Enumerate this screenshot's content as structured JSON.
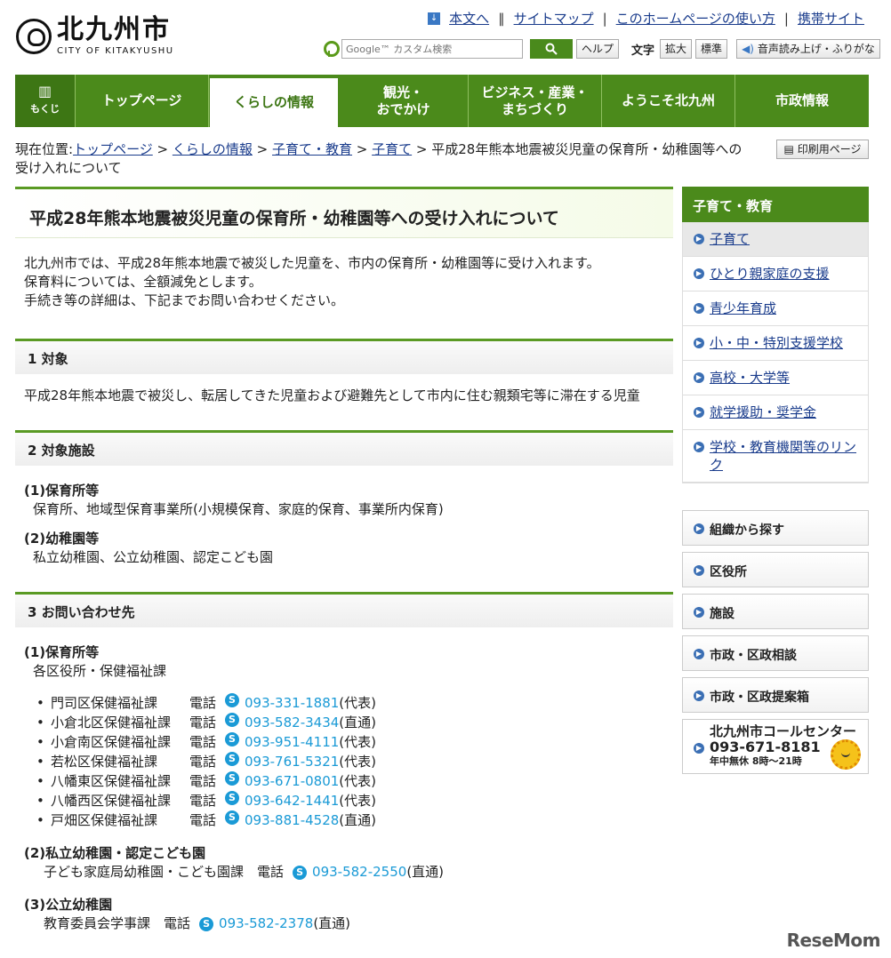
{
  "header": {
    "logo_ja": "北九州市",
    "logo_en": "CITY OF KITAKYUSHU",
    "toplinks": [
      "本文へ",
      "サイトマップ",
      "このホームページの使い方",
      "携帯サイト"
    ],
    "search_placeholder": "Google™ カスタム検索",
    "help_label": "ヘルプ",
    "text_label": "文字",
    "zoom_label": "拡大",
    "standard_label": "標準",
    "voice_label": "音声読み上げ・ふりがな"
  },
  "nav": {
    "mokuji": "もくじ",
    "items": [
      "トップページ",
      "くらしの情報",
      "観光・\nおでかけ",
      "ビジネス・産業・\nまちづくり",
      "ようこそ北九州",
      "市政情報"
    ]
  },
  "breadcrumb": {
    "prefix": "現在位置:",
    "links": [
      "トップページ",
      "くらしの情報",
      "子育て・教育",
      "子育て"
    ],
    "current": "平成28年熊本地震被災児童の保育所・幼稚園等への受け入れについて",
    "print_label": "印刷用ページ"
  },
  "main": {
    "title": "平成28年熊本地震被災児童の保育所・幼稚園等への受け入れについて",
    "intro": [
      "北九州市では、平成28年熊本地震で被災した児童を、市内の保育所・幼稚園等に受け入れます。",
      "保育料については、全額減免とします。",
      "手続き等の詳細は、下記までお問い合わせください。"
    ],
    "section1": {
      "heading": "1 対象",
      "body": "平成28年熊本地震で被災し、転居してきた児童および避難先として市内に住む親類宅等に滞在する児童"
    },
    "section2": {
      "heading": "2 対象施設",
      "sub1_title": "(1)保育所等",
      "sub1_body": "保育所、地域型保育事業所(小規模保育、家庭的保育、事業所内保育)",
      "sub2_title": "(2)幼稚園等",
      "sub2_body": "私立幼稚園、公立幼稚園、認定こども園"
    },
    "section3": {
      "heading": "3 お問い合わせ先",
      "sub1_title": "(1)保育所等",
      "sub1_body": "各区役所・保健福祉課",
      "tel_label": "電話",
      "contacts": [
        {
          "office": "門司区保健福祉課",
          "phone": "093-331-1881",
          "note": "(代表)"
        },
        {
          "office": "小倉北区保健福祉課",
          "phone": "093-582-3434",
          "note": "(直通)"
        },
        {
          "office": "小倉南区保健福祉課",
          "phone": "093-951-4111",
          "note": "(代表)"
        },
        {
          "office": "若松区保健福祉課",
          "phone": "093-761-5321",
          "note": "(代表)"
        },
        {
          "office": "八幡東区保健福祉課",
          "phone": "093-671-0801",
          "note": "(代表)"
        },
        {
          "office": "八幡西区保健福祉課",
          "phone": "093-642-1441",
          "note": "(代表)"
        },
        {
          "office": "戸畑区保健福祉課",
          "phone": "093-881-4528",
          "note": "(直通)"
        }
      ],
      "sub2_title": "(2)私立幼稚園・認定こども園",
      "sub2_office": "子ども家庭局幼稚園・こども園課",
      "sub2_phone": "093-582-2550",
      "sub2_note": "(直通)",
      "sub3_title": "(3)公立幼稚園",
      "sub3_office": "教育委員会学事課",
      "sub3_phone": "093-582-2378",
      "sub3_note": "(直通)"
    }
  },
  "sidebar": {
    "heading": "子育て・教育",
    "items": [
      "子育て",
      "ひとり親家庭の支援",
      "青少年育成",
      "小・中・特別支援学校",
      "高校・大学等",
      "就学援助・奨学金",
      "学校・教育機関等のリンク"
    ],
    "buttons": [
      "組織から探す",
      "区役所",
      "施設",
      "市政・区政相談",
      "市政・区政提案箱"
    ],
    "callcenter": {
      "name": "北九州市コールセンター",
      "tel": "093-671-8181",
      "hours": "年中無休 8時～21時"
    }
  },
  "watermark": "ReseMom"
}
